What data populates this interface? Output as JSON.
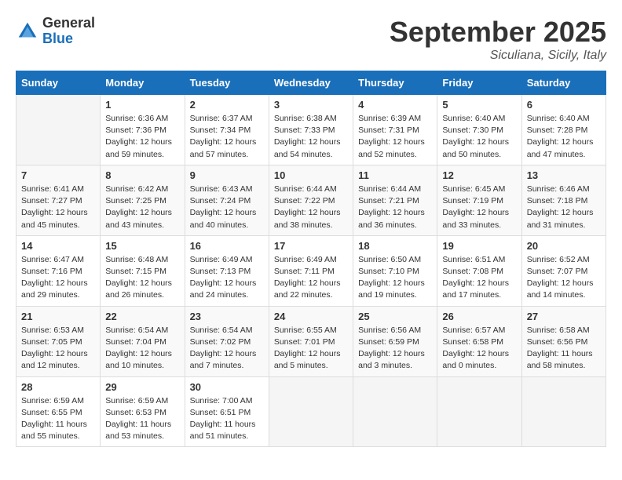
{
  "logo": {
    "general": "General",
    "blue": "Blue"
  },
  "title": "September 2025",
  "location": "Siculiana, Sicily, Italy",
  "weekdays": [
    "Sunday",
    "Monday",
    "Tuesday",
    "Wednesday",
    "Thursday",
    "Friday",
    "Saturday"
  ],
  "weeks": [
    [
      {
        "day": "",
        "info": ""
      },
      {
        "day": "1",
        "info": "Sunrise: 6:36 AM\nSunset: 7:36 PM\nDaylight: 12 hours\nand 59 minutes."
      },
      {
        "day": "2",
        "info": "Sunrise: 6:37 AM\nSunset: 7:34 PM\nDaylight: 12 hours\nand 57 minutes."
      },
      {
        "day": "3",
        "info": "Sunrise: 6:38 AM\nSunset: 7:33 PM\nDaylight: 12 hours\nand 54 minutes."
      },
      {
        "day": "4",
        "info": "Sunrise: 6:39 AM\nSunset: 7:31 PM\nDaylight: 12 hours\nand 52 minutes."
      },
      {
        "day": "5",
        "info": "Sunrise: 6:40 AM\nSunset: 7:30 PM\nDaylight: 12 hours\nand 50 minutes."
      },
      {
        "day": "6",
        "info": "Sunrise: 6:40 AM\nSunset: 7:28 PM\nDaylight: 12 hours\nand 47 minutes."
      }
    ],
    [
      {
        "day": "7",
        "info": "Sunrise: 6:41 AM\nSunset: 7:27 PM\nDaylight: 12 hours\nand 45 minutes."
      },
      {
        "day": "8",
        "info": "Sunrise: 6:42 AM\nSunset: 7:25 PM\nDaylight: 12 hours\nand 43 minutes."
      },
      {
        "day": "9",
        "info": "Sunrise: 6:43 AM\nSunset: 7:24 PM\nDaylight: 12 hours\nand 40 minutes."
      },
      {
        "day": "10",
        "info": "Sunrise: 6:44 AM\nSunset: 7:22 PM\nDaylight: 12 hours\nand 38 minutes."
      },
      {
        "day": "11",
        "info": "Sunrise: 6:44 AM\nSunset: 7:21 PM\nDaylight: 12 hours\nand 36 minutes."
      },
      {
        "day": "12",
        "info": "Sunrise: 6:45 AM\nSunset: 7:19 PM\nDaylight: 12 hours\nand 33 minutes."
      },
      {
        "day": "13",
        "info": "Sunrise: 6:46 AM\nSunset: 7:18 PM\nDaylight: 12 hours\nand 31 minutes."
      }
    ],
    [
      {
        "day": "14",
        "info": "Sunrise: 6:47 AM\nSunset: 7:16 PM\nDaylight: 12 hours\nand 29 minutes."
      },
      {
        "day": "15",
        "info": "Sunrise: 6:48 AM\nSunset: 7:15 PM\nDaylight: 12 hours\nand 26 minutes."
      },
      {
        "day": "16",
        "info": "Sunrise: 6:49 AM\nSunset: 7:13 PM\nDaylight: 12 hours\nand 24 minutes."
      },
      {
        "day": "17",
        "info": "Sunrise: 6:49 AM\nSunset: 7:11 PM\nDaylight: 12 hours\nand 22 minutes."
      },
      {
        "day": "18",
        "info": "Sunrise: 6:50 AM\nSunset: 7:10 PM\nDaylight: 12 hours\nand 19 minutes."
      },
      {
        "day": "19",
        "info": "Sunrise: 6:51 AM\nSunset: 7:08 PM\nDaylight: 12 hours\nand 17 minutes."
      },
      {
        "day": "20",
        "info": "Sunrise: 6:52 AM\nSunset: 7:07 PM\nDaylight: 12 hours\nand 14 minutes."
      }
    ],
    [
      {
        "day": "21",
        "info": "Sunrise: 6:53 AM\nSunset: 7:05 PM\nDaylight: 12 hours\nand 12 minutes."
      },
      {
        "day": "22",
        "info": "Sunrise: 6:54 AM\nSunset: 7:04 PM\nDaylight: 12 hours\nand 10 minutes."
      },
      {
        "day": "23",
        "info": "Sunrise: 6:54 AM\nSunset: 7:02 PM\nDaylight: 12 hours\nand 7 minutes."
      },
      {
        "day": "24",
        "info": "Sunrise: 6:55 AM\nSunset: 7:01 PM\nDaylight: 12 hours\nand 5 minutes."
      },
      {
        "day": "25",
        "info": "Sunrise: 6:56 AM\nSunset: 6:59 PM\nDaylight: 12 hours\nand 3 minutes."
      },
      {
        "day": "26",
        "info": "Sunrise: 6:57 AM\nSunset: 6:58 PM\nDaylight: 12 hours\nand 0 minutes."
      },
      {
        "day": "27",
        "info": "Sunrise: 6:58 AM\nSunset: 6:56 PM\nDaylight: 11 hours\nand 58 minutes."
      }
    ],
    [
      {
        "day": "28",
        "info": "Sunrise: 6:59 AM\nSunset: 6:55 PM\nDaylight: 11 hours\nand 55 minutes."
      },
      {
        "day": "29",
        "info": "Sunrise: 6:59 AM\nSunset: 6:53 PM\nDaylight: 11 hours\nand 53 minutes."
      },
      {
        "day": "30",
        "info": "Sunrise: 7:00 AM\nSunset: 6:51 PM\nDaylight: 11 hours\nand 51 minutes."
      },
      {
        "day": "",
        "info": ""
      },
      {
        "day": "",
        "info": ""
      },
      {
        "day": "",
        "info": ""
      },
      {
        "day": "",
        "info": ""
      }
    ]
  ]
}
